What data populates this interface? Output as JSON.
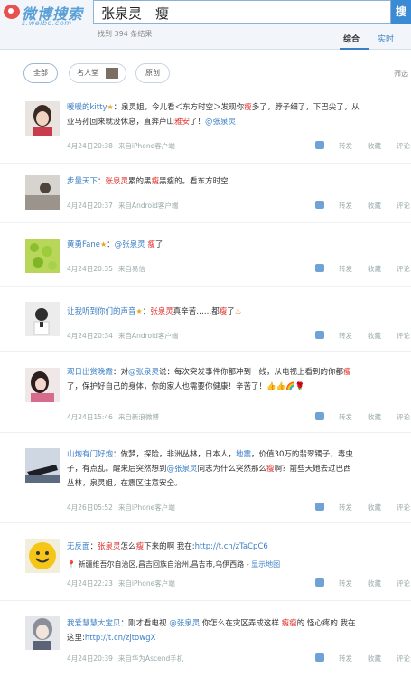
{
  "header": {
    "logo_title": "微博搜索",
    "logo_sub": "s.weibo.com",
    "query": "张泉灵　瘦",
    "search_button": "搜",
    "result_count": "找到 394 条结果",
    "sort_tabs": [
      "综合",
      "实时"
    ]
  },
  "filters": {
    "pills": [
      "全部",
      "名人堂",
      "原创"
    ],
    "more_label": "筛选"
  },
  "actions": [
    "转发",
    "收藏",
    "评论"
  ],
  "feed": [
    {
      "user": "暖暖的kitty",
      "line1": "：泉灵姐，今儿看＜东方时空＞发现你",
      "kw1": "瘦",
      "line1b": "多了，脖子细了，下巴尖了，从",
      "line2": "亚马孙回来就没休息，直奔芦山",
      "kw2": "雅安",
      "line2b": "了！",
      "mention": "@张泉灵",
      "time": "4月24日20:38",
      "source": "来自iPhone客户端"
    },
    {
      "user": "步量天下",
      "text_a": "：",
      "kw1": "张泉灵",
      "text_b": "累的黑",
      "kw2": "瘦",
      "text_c": "黑瘦的。看东方时空",
      "time": "4月24日20:37",
      "source": "来自Android客户端"
    },
    {
      "user": "黄勇Fane",
      "text_a": "：",
      "mention": "@张泉灵",
      "kw1": "瘦",
      "text_b": "了",
      "time": "4月24日20:35",
      "source": "来自易信"
    },
    {
      "user": "让我听到你们的声音",
      "text_a": "：",
      "kw1": "张泉灵",
      "text_b": "真辛苦……都",
      "kw2": "瘦",
      "text_c": "了",
      "time": "4月24日20:34",
      "source": "来自Android客户端"
    },
    {
      "user": "观日出赏晚霞",
      "line1a": "：对",
      "mention": "@张泉灵",
      "line1b": "说：每次突发事件你都冲到一线，从电视上看到的你都",
      "kw1": "瘦",
      "line2": "了，保护好自己的身体，你的家人也需要你健康！辛苦了！",
      "time": "4月24日15:46",
      "source": "来自新浪微博"
    },
    {
      "user": "山炮有门好炮",
      "line1a": "：做梦，探险，非洲丛林，日本人，",
      "kw1": "地震",
      "line1b": "，价值30万的翡翠镯子，毒虫",
      "line2a": "子，有点乱。醒来后突然想到",
      "mention": "@张泉灵",
      "line2b": "同志为什么突然那么",
      "kw2": "瘦",
      "line2c": "啊？前些天她去过巴西",
      "line3": "丛林，泉灵姐，在震区注意安全。",
      "time": "4月26日05:52",
      "source": "来自iPhone客户端"
    },
    {
      "user": "无反面",
      "text_a": "：",
      "kw1": "张泉灵",
      "text_b": "怎么",
      "kw2": "瘦",
      "text_c": "下来的啊 我在:",
      "link": "http://t.cn/zTaCpC6",
      "location": "新疆维吾尔自治区,昌吉回族自治州,昌吉市,乌伊西路",
      "map_link": "显示地图",
      "time": "4月24日22:23",
      "source": "来自iPhone客户端"
    },
    {
      "user": "我爱慧慧大宝贝",
      "line1a": "：刚才看电视 ",
      "mention": "@张泉灵",
      "line1b": " 你怎么在灾区弄成这样 ",
      "kw1": "瘦瘦",
      "line1c": "的 怪心疼的 我在",
      "line2a": "这里:",
      "link": "http://t.cn/zjtowgX",
      "time": "4月24日20:39",
      "source": "来自华为Ascend手机"
    }
  ]
}
